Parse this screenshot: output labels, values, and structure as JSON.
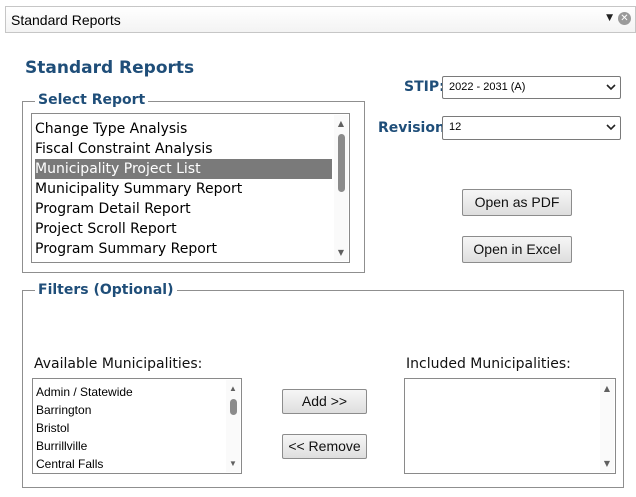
{
  "window": {
    "title": "Standard Reports"
  },
  "page": {
    "title": "Standard Reports"
  },
  "select_report": {
    "legend": "Select Report",
    "items": [
      "Change Type Analysis",
      "Fiscal Constraint Analysis",
      "Municipality Project List",
      "Municipality Summary Report",
      "Program Detail Report",
      "Project Scroll Report",
      "Program Summary Report"
    ],
    "selected": "Municipality Project List"
  },
  "stip": {
    "label": "STIP:",
    "value": "2022 - 2031 (A)"
  },
  "revision": {
    "label": "Revision:",
    "value": "12"
  },
  "actions": {
    "open_pdf": "Open as PDF",
    "open_excel": "Open in Excel"
  },
  "filters": {
    "legend": "Filters (Optional)",
    "available_label": "Available Municipalities:",
    "included_label": "Included Municipalities:",
    "available": [
      "Admin / Statewide",
      "Barrington",
      "Bristol",
      "Burrillville",
      "Central Falls"
    ],
    "included": [],
    "add_label": "Add >>",
    "remove_label": "<< Remove"
  },
  "colors": {
    "accent": "#1f4e79",
    "selection": "#7a7a7a"
  }
}
